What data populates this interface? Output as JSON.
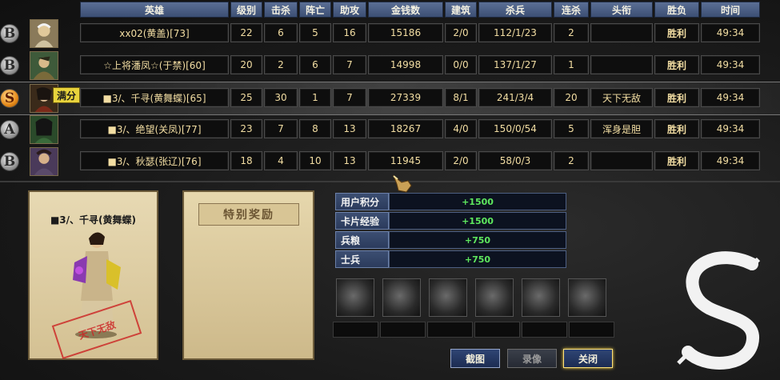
{
  "columns": [
    "英雄",
    "级别",
    "击杀",
    "阵亡",
    "助攻",
    "金钱数",
    "建筑",
    "杀兵",
    "连杀",
    "头衔",
    "胜负",
    "时间"
  ],
  "players": [
    {
      "grade": "B",
      "hero": "xx02(黄盖)[73]",
      "level": "22",
      "kills": "6",
      "deaths": "5",
      "assists": "16",
      "gold": "15186",
      "buildings": "2/0",
      "creeps": "112/1/23",
      "streak": "2",
      "title": "",
      "result": "胜利",
      "time": "49:34"
    },
    {
      "grade": "B",
      "hero": "☆上将潘凤☆(于禁)[60]",
      "level": "20",
      "kills": "2",
      "deaths": "6",
      "assists": "7",
      "gold": "14998",
      "buildings": "0/0",
      "creeps": "137/1/27",
      "streak": "1",
      "title": "",
      "result": "胜利",
      "time": "49:34"
    },
    {
      "grade": "S",
      "hero": "■3/、千寻(黄舞蝶)[65]",
      "level": "25",
      "kills": "30",
      "deaths": "1",
      "assists": "7",
      "gold": "27339",
      "buildings": "8/1",
      "creeps": "241/3/4",
      "streak": "20",
      "title": "天下无敌",
      "result": "胜利",
      "time": "49:34"
    },
    {
      "grade": "A",
      "hero": "■3/、绝望(关凤)[77]",
      "level": "23",
      "kills": "7",
      "deaths": "8",
      "assists": "13",
      "gold": "18267",
      "buildings": "4/0",
      "creeps": "150/0/54",
      "streak": "5",
      "title": "浑身是胆",
      "result": "胜利",
      "time": "49:34"
    },
    {
      "grade": "B",
      "hero": "■3/、秋瑟(张辽)[76]",
      "level": "18",
      "kills": "4",
      "deaths": "10",
      "assists": "13",
      "gold": "11945",
      "buildings": "2/0",
      "creeps": "58/0/3",
      "streak": "2",
      "title": "",
      "result": "胜利",
      "time": "49:34"
    }
  ],
  "max_badge": "满分",
  "card": {
    "name": "■3/、千寻(黄舞蝶)",
    "stamp": "天下无敌"
  },
  "special_reward_title": "特别奖励",
  "rewards": [
    {
      "label": "用户积分",
      "value": "+1500"
    },
    {
      "label": "卡片经验",
      "value": "+1500"
    },
    {
      "label": "兵粮",
      "value": "+750"
    },
    {
      "label": "士兵",
      "value": "+750"
    }
  ],
  "buttons": {
    "screenshot": "截图",
    "replay": "录像",
    "close": "关闭"
  },
  "icons": {
    "cursor": "gauntlet-pointer-icon",
    "logo": "brush-s-logo",
    "slot": "locked-item-icon"
  }
}
